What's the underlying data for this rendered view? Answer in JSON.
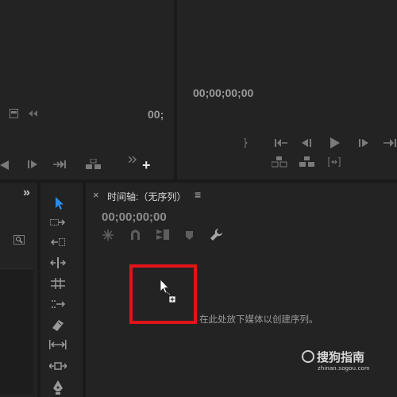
{
  "source_monitor": {
    "timecode": "00;",
    "add_icon": "+"
  },
  "program_monitor": {
    "timecode": "00;00;00;00"
  },
  "project_panel": {
    "expand_label": "»"
  },
  "timeline": {
    "close_label": "×",
    "title": "时间轴:（无序列）",
    "menu_label": "≡",
    "timecode": "00;00;00;00",
    "drop_hint": "在此处放下媒体以创建序列。"
  },
  "watermark": {
    "brand": "搜狗指南",
    "url": "zhinan.sogou.com"
  },
  "colors": {
    "panel_bg": "#232323",
    "gap_bg": "#1a1a1a",
    "selection_tool": "#2d8ceb",
    "highlight_box": "#e0141a",
    "icon_gray": "#7a7a7a"
  },
  "icons": [
    "export-frame-icon",
    "step-back-icon",
    "step-forward-icon",
    "insert-icon",
    "overwrite-icon",
    "play-icon",
    "go-to-in-icon",
    "go-to-out-icon",
    "lift-icon",
    "extract-icon",
    "compare-icon",
    "snap-icon",
    "linked-selection-icon",
    "marker-icon",
    "wrench-icon",
    "selection-tool-icon",
    "track-select-tool-icon",
    "ripple-edit-tool-icon",
    "rolling-edit-tool-icon",
    "rate-stretch-tool-icon",
    "razor-tool-icon",
    "slip-tool-icon",
    "slide-tool-icon",
    "pen-tool-icon",
    "cursor-icon",
    "find-icon"
  ]
}
